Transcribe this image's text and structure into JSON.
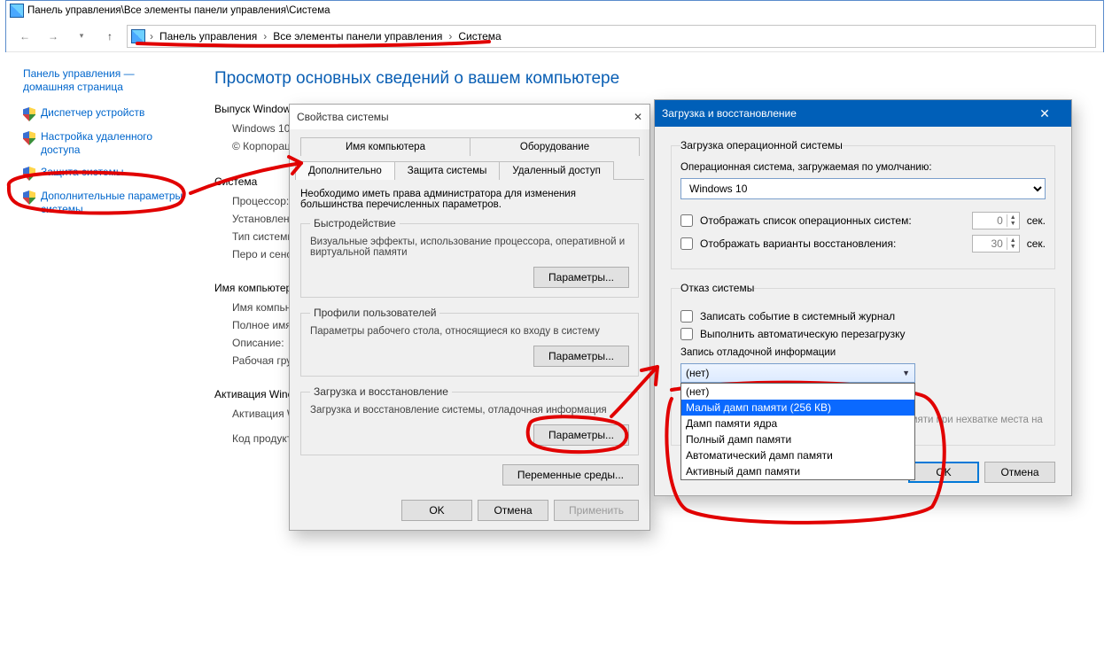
{
  "window": {
    "title": "Панель управления\\Все элементы панели управления\\Система"
  },
  "breadcrumb": {
    "items": [
      "Панель управления",
      "Все элементы панели управления",
      "Система"
    ]
  },
  "sidebar": {
    "home": "Панель управления — домашняя страница",
    "links": [
      "Диспетчер устройств",
      "Настройка удаленного доступа",
      "Защита системы",
      "Дополнительные параметры системы"
    ]
  },
  "page": {
    "heading": "Просмотр основных сведений о вашем компьютере",
    "sec_edition": "Выпуск Windows",
    "edition_line1": "Windows 10",
    "edition_line2": "© Корпорац",
    "sec_system": "Система",
    "sys_labels": {
      "cpu": "Процессор:",
      "ram": "Установленн (ОЗУ):",
      "type": "Тип системы",
      "pen": "Перо и сенс"
    },
    "sec_name": "Имя компьютера",
    "name_labels": {
      "name": "Имя компьн",
      "full": "Полное имя",
      "desc": "Описание:",
      "wg": "Рабочая гру"
    },
    "sec_act": "Активация Winc",
    "act_label": "Активация W",
    "prod_label": "Код продукт"
  },
  "dlg1": {
    "title": "Свойства системы",
    "tabs_row1": [
      "Имя компьютера",
      "Оборудование"
    ],
    "tabs_row2": [
      "Дополнительно",
      "Защита системы",
      "Удаленный доступ"
    ],
    "note": "Необходимо иметь права администратора для изменения большинства перечисленных параметров.",
    "perf_title": "Быстродействие",
    "perf_desc": "Визуальные эффекты, использование процессора, оперативной и виртуальной памяти",
    "profiles_title": "Профили пользователей",
    "profiles_desc": "Параметры рабочего стола, относящиеся ко входу в систему",
    "boot_title": "Загрузка и восстановление",
    "boot_desc": "Загрузка и восстановление системы, отладочная информация",
    "params_btn": "Параметры...",
    "env_btn": "Переменные среды...",
    "ok": "OK",
    "cancel": "Отмена",
    "apply": "Применить"
  },
  "dlg2": {
    "title": "Загрузка и восстановление",
    "grp_boot": "Загрузка операционной системы",
    "default_os_label": "Операционная система, загружаемая по умолчанию:",
    "default_os_value": "Windows 10",
    "chk_list": "Отображать список операционных систем:",
    "chk_recovery": "Отображать варианты восстановления:",
    "sec_unit": "сек.",
    "spin1": "0",
    "spin2": "30",
    "grp_fail": "Отказ системы",
    "chk_log": "Записать событие в системный журнал",
    "chk_reboot": "Выполнить автоматическую перезагрузку",
    "dump_label": "Запись отладочной информации",
    "combo_value": "(нет)",
    "combo_options": [
      "(нет)",
      "Малый дамп памяти (256 КВ)",
      "Дамп памяти ядра",
      "Полный дамп памяти",
      "Автоматический дамп памяти",
      "Активный дамп памяти"
    ],
    "overlay_text": "Отключить автоматическое удаление дампов памяти при нехватке места на диске",
    "ok": "OK",
    "cancel": "Отмена"
  }
}
